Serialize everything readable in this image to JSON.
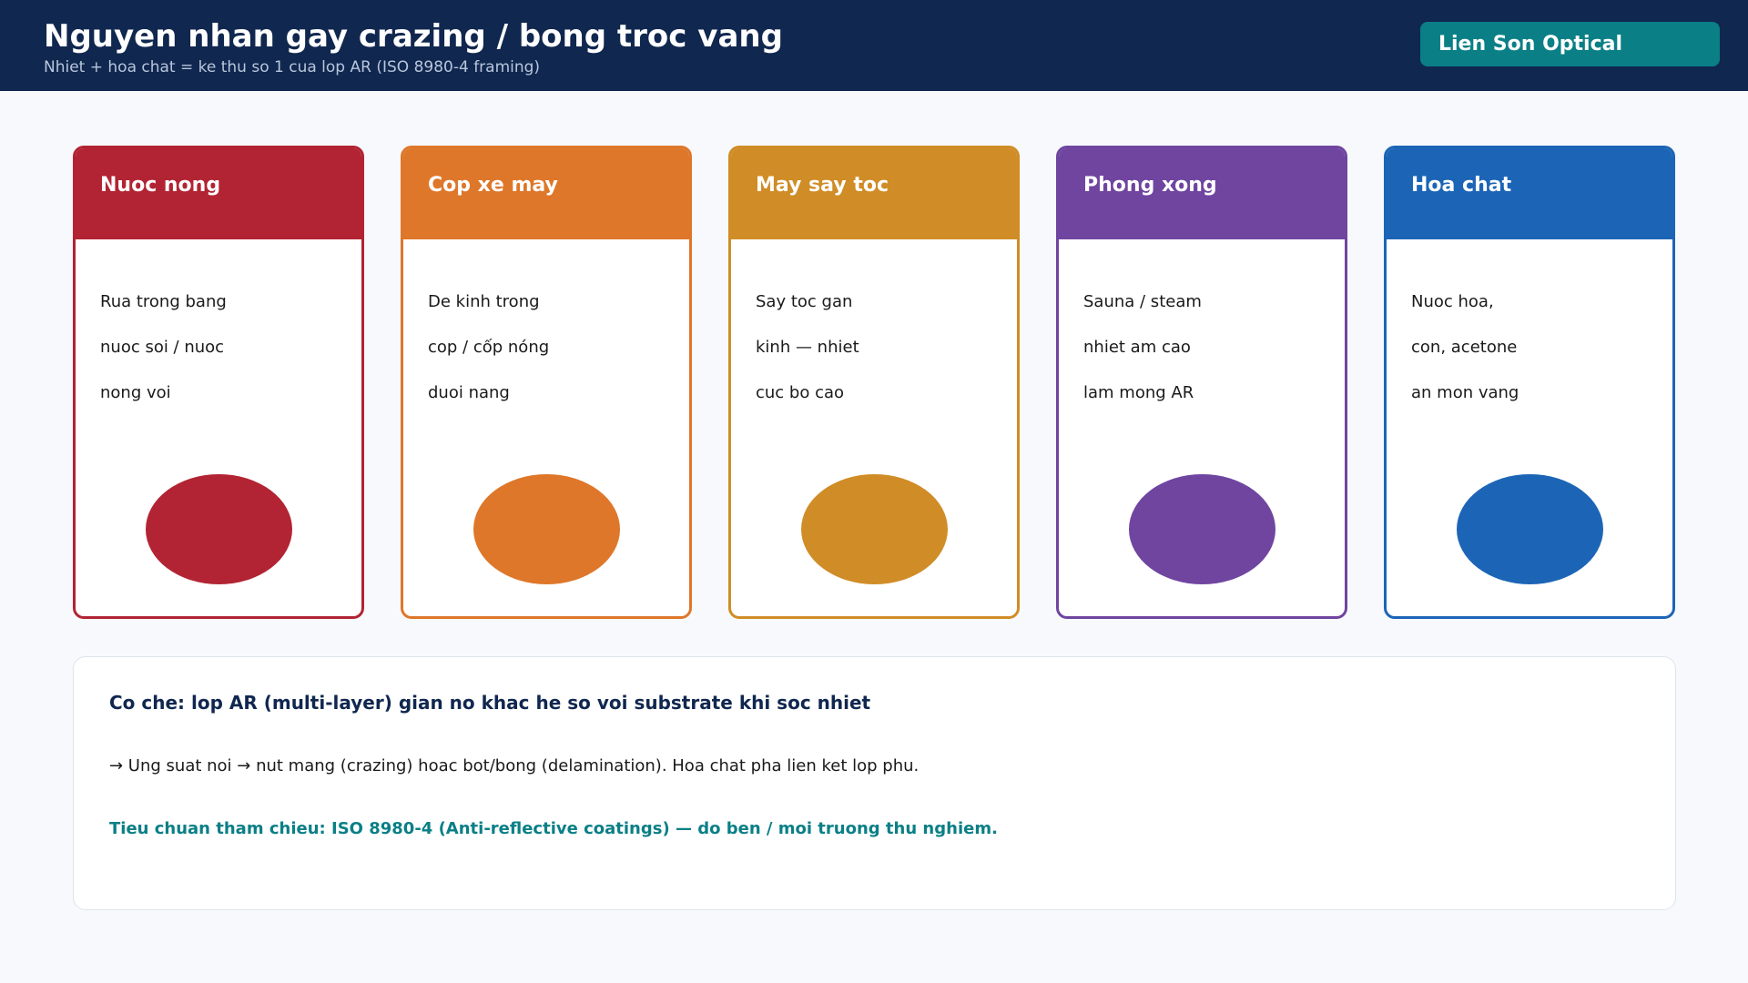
{
  "header": {
    "title": "Nguyen nhan gay crazing / bong troc vang",
    "subtitle": "Nhiet + hoa chat = ke thu so 1 cua lop AR (ISO 8980-4 framing)",
    "brand": "Lien Son Optical"
  },
  "cards": [
    {
      "title": "Nuoc nong",
      "lines": [
        "Rua trong bang",
        "nuoc soi / nuoc",
        "nong voi"
      ],
      "color": "#b22433"
    },
    {
      "title": "Cop xe may",
      "lines": [
        "De kinh trong",
        "cop / cốp nóng",
        "duoi nang"
      ],
      "color": "#de772a"
    },
    {
      "title": "May say toc",
      "lines": [
        "Say toc gan",
        "kinh — nhiet",
        "cuc bo cao"
      ],
      "color": "#d08c26"
    },
    {
      "title": "Phong xong",
      "lines": [
        "Sauna / steam",
        "nhiet am cao",
        "lam mong AR"
      ],
      "color": "#6f45a0"
    },
    {
      "title": "Hoa chat",
      "lines": [
        "Nuoc hoa,",
        "con, acetone",
        "an mon vang"
      ],
      "color": "#1c65b6"
    }
  ],
  "mechanism": {
    "title": "Co che: lop AR (multi-layer) gian no khac he so voi substrate khi soc nhiet",
    "text": "→ Ung suat noi → nut mang (crazing) hoac bot/bong (delamination). Hoa chat pha lien ket lop phu.",
    "standard": "Tieu chuan tham chieu: ISO 8980-4 (Anti-reflective coatings) — do ben / moi truong thu nghiem."
  }
}
